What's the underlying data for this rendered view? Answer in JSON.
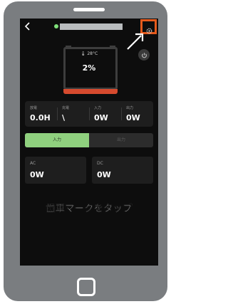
{
  "topbar": {
    "back_icon": "back-arrow-icon",
    "status_color": "#7fe07a",
    "settings_icon": "gear-icon",
    "highlight_color": "#e55a1c"
  },
  "device": {
    "temperature": "28°C",
    "battery_percent": "2%",
    "accent_color": "#d64a2e"
  },
  "stats": [
    {
      "label": "放電",
      "value": "0.0H"
    },
    {
      "label": "充電",
      "value": "\\"
    },
    {
      "label": "入力",
      "value": "0W"
    },
    {
      "label": "出力",
      "value": "0W"
    }
  ],
  "tabs": {
    "input": "入力",
    "output": "出力",
    "active_color": "#8fd07e"
  },
  "cards": {
    "ac": {
      "label": "AC",
      "value": "0W"
    },
    "dc": {
      "label": "DC",
      "value": "0W"
    }
  },
  "caption": "歯車マークをタップ"
}
